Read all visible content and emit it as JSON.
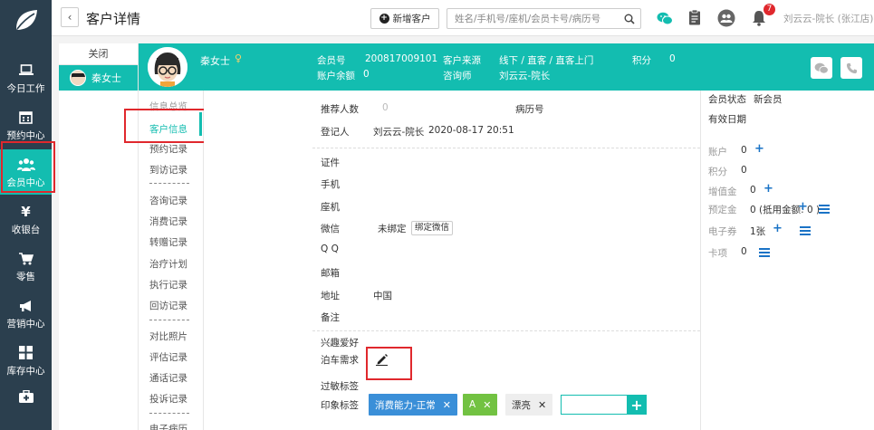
{
  "nav": {
    "items": [
      {
        "label": "今日工作",
        "icon": "laptop-icon"
      },
      {
        "label": "预约中心",
        "icon": "calendar-icon"
      },
      {
        "label": "会员中心",
        "icon": "members-icon"
      },
      {
        "label": "收银台",
        "icon": "yen-icon"
      },
      {
        "label": "零售",
        "icon": "cart-icon"
      },
      {
        "label": "营销中心",
        "icon": "megaphone-icon"
      },
      {
        "label": "库存中心",
        "icon": "grid-icon"
      },
      {
        "label": "",
        "icon": "medkit-icon"
      }
    ]
  },
  "header": {
    "title": "客户详情",
    "new_customer": "新增客户",
    "search_placeholder": "姓名/手机号/座机/会员卡号/病历号",
    "notification_count": "7",
    "user": "刘云云-院长 (张江店)"
  },
  "tabs": {
    "close_label": "关闭",
    "open_tab": "秦女士"
  },
  "banner": {
    "name": "秦女士",
    "member_no_label": "会员号",
    "member_no": "200817009101",
    "source_label": "客户来源",
    "source": "线下 / 直客 / 直客上门",
    "points_label": "积分",
    "points": "0",
    "balance_label": "账户余额",
    "balance": "0",
    "consultant_label": "咨询师",
    "consultant": "刘云云-院长"
  },
  "submenu": {
    "items": [
      "信息总览",
      "客户信息",
      "预约记录",
      "到访记录",
      "咨询记录",
      "消费记录",
      "转赠记录",
      "治疗计划",
      "执行记录",
      "回访记录",
      "对比照片",
      "评估记录",
      "通话记录",
      "投诉记录",
      "电子病历"
    ]
  },
  "form": {
    "referrals_label": "推荐人数",
    "referrals_value": "0",
    "record_no_label": "病历号",
    "registrar_label": "登记人",
    "registrar_value": "刘云云-院长",
    "registered_at": "2020-08-17 20:51",
    "id_label": "证件",
    "phone_label": "手机",
    "landline_label": "座机",
    "wechat_label": "微信",
    "wechat_status": "未绑定",
    "bind_wechat": "绑定微信",
    "qq_label": "Q Q",
    "email_label": "邮箱",
    "address_label": "地址",
    "address_value": "中国",
    "notes_label": "备注",
    "hobbies_label": "兴趣爱好",
    "parking_label": "泊车需求",
    "allergy_label": "过敏标签",
    "impression_label": "印象标签",
    "tags": [
      {
        "label": "消费能力-正常",
        "bg": "#3a8fd8",
        "fg": "#ffffff"
      },
      {
        "label": "A",
        "bg": "#72c242",
        "fg": "#ffffff"
      },
      {
        "label": "漂亮",
        "bg": "#eeeeee",
        "fg": "#333333"
      }
    ]
  },
  "rpanel": {
    "status_label": "会员状态",
    "status_value": "新会员",
    "valid_label": "有效日期",
    "account_label": "账户",
    "account_value": "0",
    "points_label": "积分",
    "points_value": "0",
    "stored_label": "增值金",
    "stored_value": "0",
    "deposit_label": "预定金",
    "deposit_value": "0 (抵用金额: 0 )",
    "coupon_label": "电子券",
    "coupon_value": "1张",
    "card_label": "卡项",
    "card_value": "0"
  },
  "colors": {
    "accent": "#13bdb0",
    "nav_bg": "#2b3f4e",
    "highlight": "#e0282d",
    "link": "#1a73c6"
  }
}
